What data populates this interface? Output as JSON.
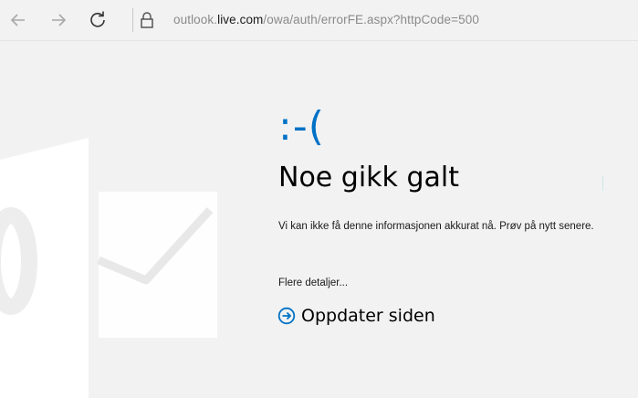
{
  "browser": {
    "url_prefix": "outlook.",
    "url_domain": "live.com",
    "url_path": "/owa/auth/errorFE.aspx?httpCode=500"
  },
  "error_page": {
    "face": ":-(",
    "title": "Noe gikk galt",
    "message": "Vi kan ikke få denne informasjonen akkurat nå. Prøv på nytt senere.",
    "details_link": "Flere detaljer...",
    "refresh_label": "Oppdater siden"
  },
  "colors": {
    "accent": "#0072c6",
    "background": "#f2f2f2",
    "logo_watermark": "#ffffff"
  },
  "icons": {
    "back": "arrow-left-icon",
    "forward": "arrow-right-icon",
    "reload": "reload-icon",
    "lock": "lock-icon",
    "refresh": "circle-arrow-right-icon",
    "logo": "outlook-logo"
  }
}
